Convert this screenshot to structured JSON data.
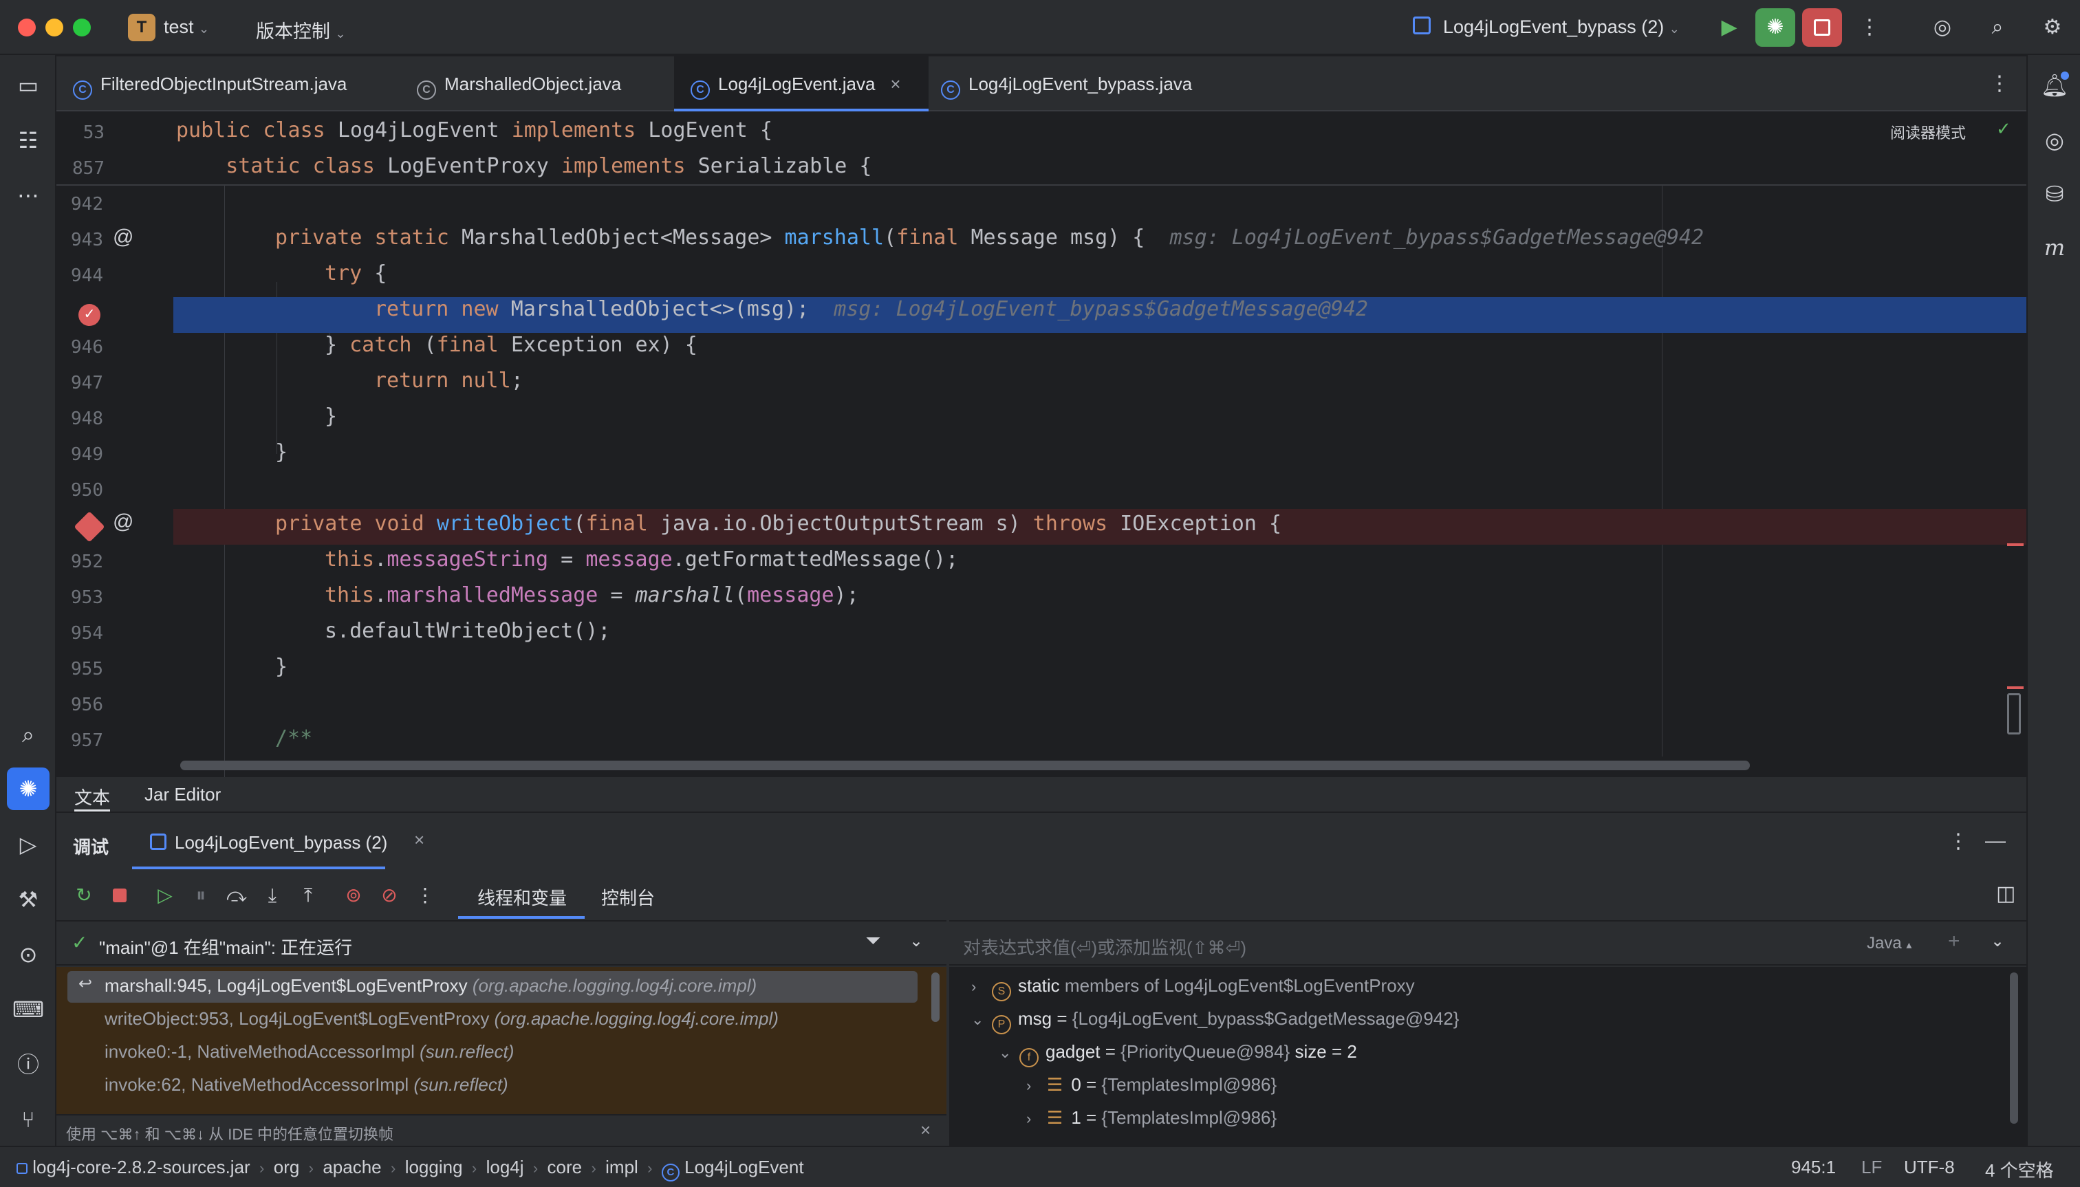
{
  "titlebar": {
    "project_badge": "T",
    "project_name": "test",
    "vcs": "版本控制",
    "run_config": "Log4jLogEvent_bypass (2)"
  },
  "tabs": [
    {
      "label": "FilteredObjectInputStream.java"
    },
    {
      "label": "MarshalledObject.java"
    },
    {
      "label": "Log4jLogEvent.java",
      "close": "×"
    },
    {
      "label": "Log4jLogEvent_bypass.java"
    }
  ],
  "editor": {
    "reader_mode": "阅读器模式",
    "sticky": [
      {
        "line": "53",
        "code": "public class Log4jLogEvent implements LogEvent {"
      },
      {
        "line": "857",
        "code": "    static class LogEventProxy implements Serializable {"
      }
    ],
    "lines": {
      "l942": "942",
      "l943": "943",
      "l944": "944",
      "l946": "946",
      "l947": "947",
      "l948": "948",
      "l949": "949",
      "l950": "950",
      "l952": "952",
      "l953": "953",
      "l954": "954",
      "l955": "955",
      "l956": "956",
      "l957": "957"
    },
    "hints": {
      "h943": "msg: Log4jLogEvent_bypass$GadgetMessage@942",
      "h945": "msg: Log4jLogEvent_bypass$GadgetMessage@942"
    }
  },
  "editor_tabs": {
    "text": "文本",
    "jar": "Jar Editor"
  },
  "debug": {
    "title": "调试",
    "session": "Log4jLogEvent_bypass (2)",
    "tab_threads": "线程和变量",
    "tab_console": "控制台",
    "thread_status": "\"main\"@1 在组\"main\": 正在运行",
    "eval_placeholder": "对表达式求值(⏎)或添加监视(⇧⌘⏎)",
    "lang": "Java",
    "frames": [
      {
        "name": "marshall:945, Log4jLogEvent$LogEventProxy",
        "pkg": "(org.apache.logging.log4j.core.impl)"
      },
      {
        "name": "writeObject:953, Log4jLogEvent$LogEventProxy",
        "pkg": "(org.apache.logging.log4j.core.impl)"
      },
      {
        "name": "invoke0:-1, NativeMethodAccessorImpl",
        "pkg": "(sun.reflect)"
      },
      {
        "name": "invoke:62, NativeMethodAccessorImpl",
        "pkg": "(sun.reflect)"
      }
    ],
    "frames_hint": "使用 ⌥⌘↑ 和 ⌥⌘↓ 从 IDE 中的任意位置切换帧",
    "vars": {
      "static": {
        "name": "static",
        "rest": "members of Log4jLogEvent$LogEventProxy"
      },
      "msg": {
        "name": "msg",
        "value": "{Log4jLogEvent_bypass$GadgetMessage@942}"
      },
      "gadget": {
        "name": "gadget",
        "value": "{PriorityQueue@984}",
        "size": "size = 2"
      },
      "item0": {
        "name": "0",
        "value": "{TemplatesImpl@986}"
      },
      "item1": {
        "name": "1",
        "value": "{TemplatesImpl@986}"
      }
    }
  },
  "statusbar": {
    "crumbs": [
      "log4j-core-2.8.2-sources.jar",
      "org",
      "apache",
      "logging",
      "log4j",
      "core",
      "impl",
      "Log4jLogEvent"
    ],
    "position": "945:1",
    "line_sep": "LF",
    "encoding": "UTF-8",
    "indent": "4 个空格"
  },
  "colors": {
    "accent": "#548af7",
    "selection": "#214283",
    "breakpoint": "#db5c5c",
    "run_green": "#499c54",
    "stop_red": "#c94f4f"
  }
}
